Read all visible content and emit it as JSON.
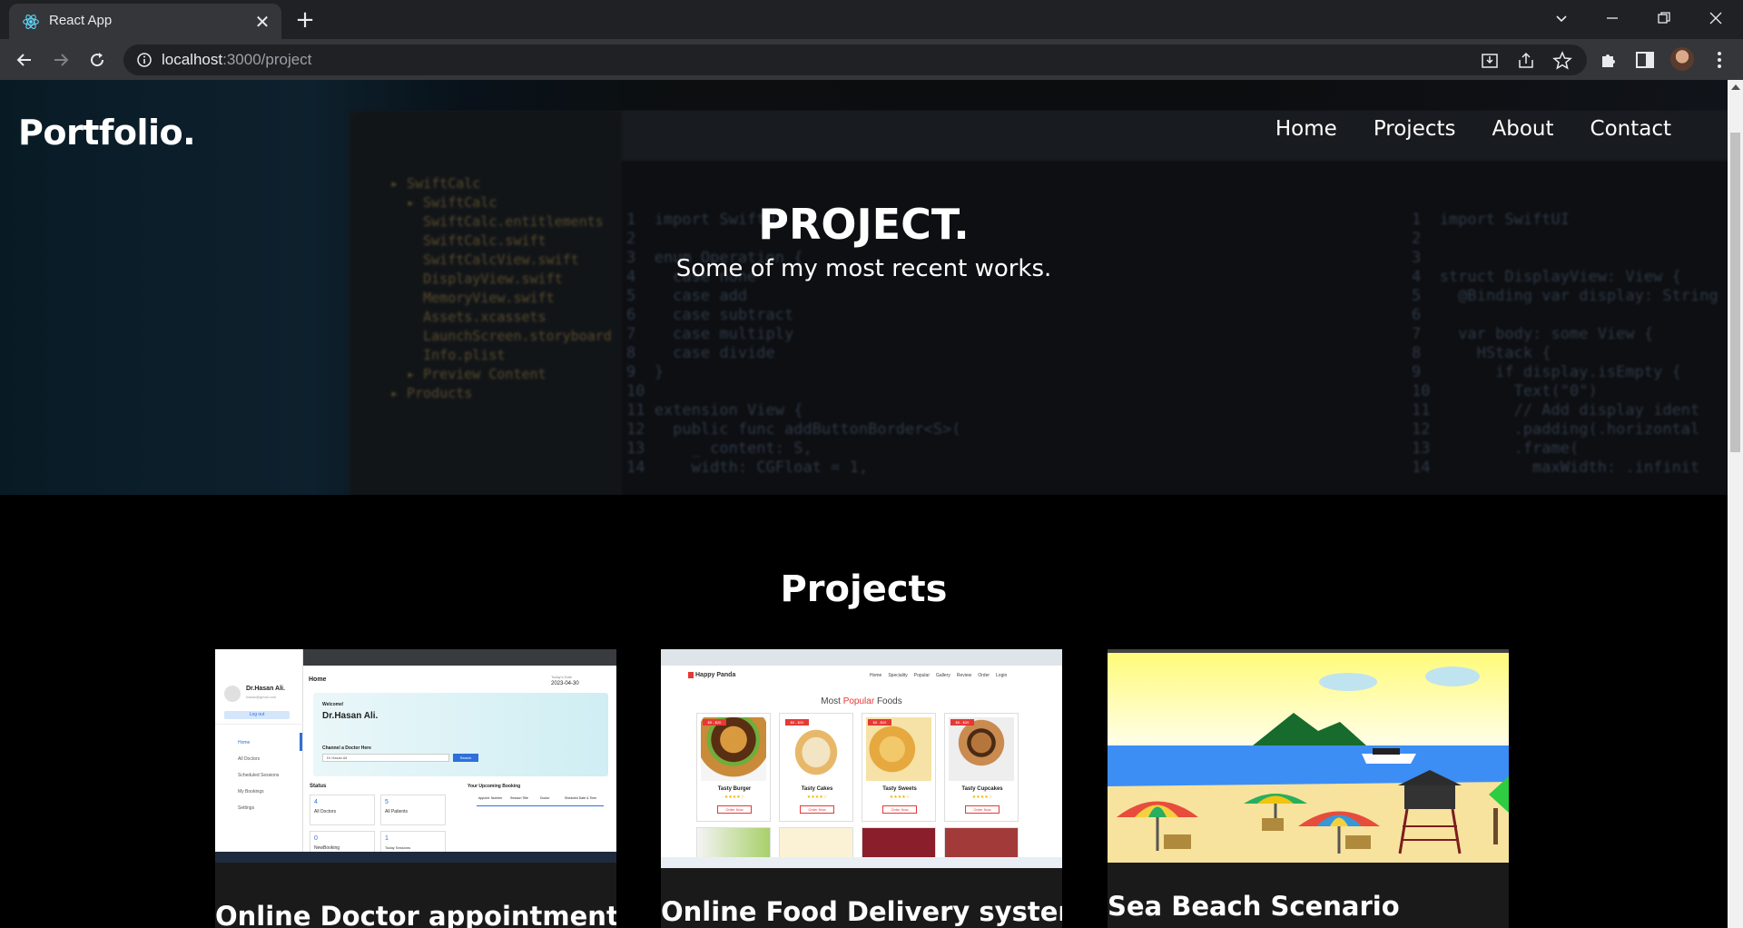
{
  "browser": {
    "tab_title": "React App",
    "url_host": "localhost",
    "url_path": ":3000/project"
  },
  "site": {
    "logo": "Portfolio.",
    "nav": [
      {
        "label": "Home"
      },
      {
        "label": "Projects"
      },
      {
        "label": "About"
      },
      {
        "label": "Contact"
      }
    ]
  },
  "hero": {
    "title": "PROJECT.",
    "subtitle": "Some of my most recent works.",
    "code_left": "1  import SwiftUI\n2\n3  enum Operation {\n4    case none\n5    case add\n6    case subtract\n7    case multiply\n8    case divide\n9  }\n10\n11 extension View {\n12   public func addButtonBorder<S>(\n13     _ content: S,\n14     width: CGFloat = 1,",
    "code_right": "1  import SwiftUI\n2\n3\n4  struct DisplayView: View {\n5    @Binding var display: String\n6\n7    var body: some View {\n8      HStack {\n9        if display.isEmpty {\n10         Text(\"0\")\n11         // Add display ident\n12         .padding(.horizontal\n13         .frame(\n14           maxWidth: .infinit"
  },
  "projects": {
    "heading": "Projects",
    "items": [
      {
        "title": "Online Doctor appointment",
        "shot": {
          "user_name": "Dr.Hasan Ali.",
          "user_email": "hasan@gmail.com",
          "logout": "Log out",
          "menu": [
            "Home",
            "All Doctors",
            "Scheduled Sessions",
            "My Bookings",
            "Settings"
          ],
          "page": "Home",
          "date_label": "Today's Date",
          "date": "2023-04-30",
          "welcome": "Welcome!",
          "welcome_name": "Dr.Hasan Ali.",
          "channel": "Channel a Doctor Here",
          "search_value": "Dr Hasan Ali",
          "search_btn": "Search",
          "status": "Status",
          "stats": [
            {
              "value": "4",
              "label": "All Doctors"
            },
            {
              "value": "5",
              "label": "All Patients"
            },
            {
              "value": "0",
              "label": "NewBooking"
            },
            {
              "value": "1",
              "label": "Today Sessions"
            }
          ],
          "upcoming": "Your Upcoming Booking",
          "upcoming_cols": [
            "Appoint. Number",
            "Session Title",
            "Doctor",
            "Sheduled Date & Time"
          ]
        }
      },
      {
        "title": "Online Food Delivery system",
        "shot": {
          "brand": "Happy Panda",
          "menu": [
            "Home",
            "Speciality",
            "Popular",
            "Gallery",
            "Review",
            "Order",
            "Login"
          ],
          "heading_a": "Most",
          "heading_b": "Popular",
          "heading_c": "Foods",
          "price_tag": "$5 - $20",
          "order_btn": "Order Now",
          "foods": [
            "Tasty Burger",
            "Tasty Cakes",
            "Tasty Sweets",
            "Tasty Cupcakes"
          ]
        }
      },
      {
        "title": "Sea Beach Scenario",
        "shot": {}
      }
    ]
  },
  "colors": {
    "chrome_dark": "#202124",
    "chrome_toolbar": "#35363a",
    "card_bg": "#1a1a1a",
    "food_accent": "#e53935"
  }
}
